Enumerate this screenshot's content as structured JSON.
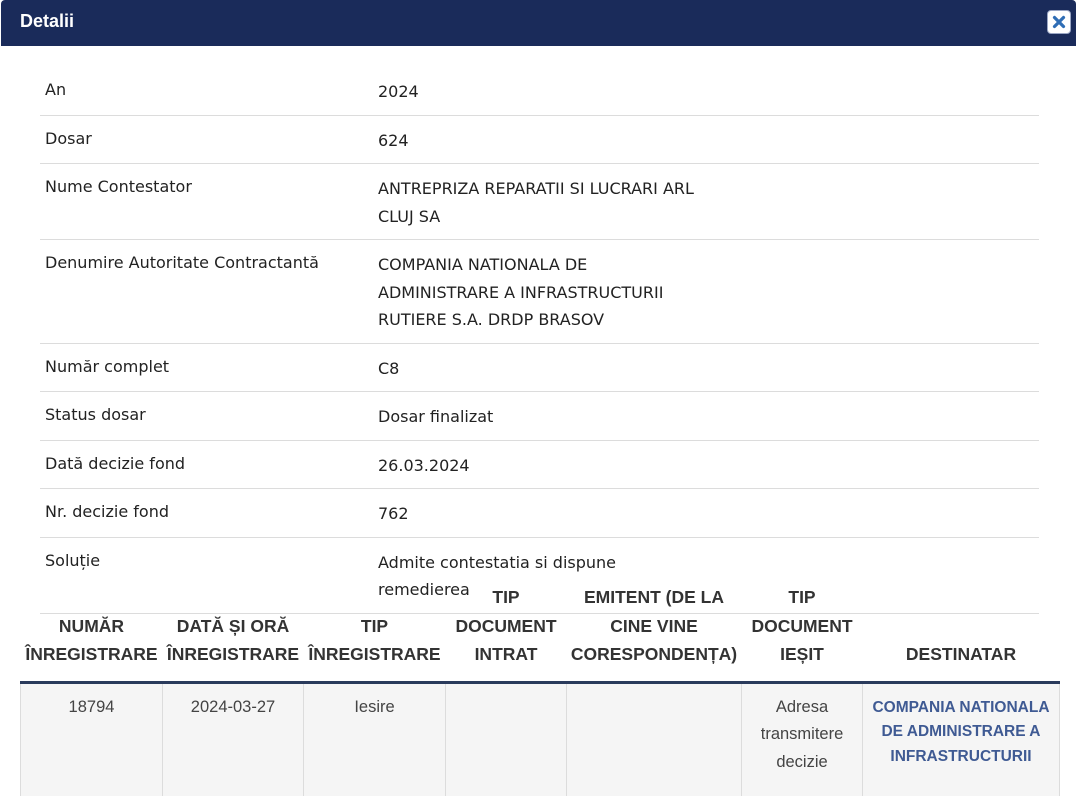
{
  "window": {
    "title": "Detalii"
  },
  "details": [
    {
      "label": "An",
      "value": "2024"
    },
    {
      "label": "Dosar",
      "value": "624"
    },
    {
      "label": "Nume Contestator",
      "value": "ANTREPRIZA REPARATII SI LUCRARI ARL CLUJ SA"
    },
    {
      "label": "Denumire Autoritate Contractantă",
      "value": "COMPANIA NATIONALA DE ADMINISTRARE A INFRASTRUCTURII RUTIERE S.A. DRDP BRASOV"
    },
    {
      "label": "Număr complet",
      "value": "C8"
    },
    {
      "label": "Status dosar",
      "value": "Dosar finalizat"
    },
    {
      "label": "Dată decizie fond",
      "value": "26.03.2024"
    },
    {
      "label": "Nr. decizie fond",
      "value": "762"
    },
    {
      "label": "Soluție",
      "value": "Admite contestatia si dispune remedierea"
    }
  ],
  "table": {
    "columns": [
      "NUMĂR ÎNREGISTRARE",
      "DATĂ ȘI ORĂ ÎNREGISTRARE",
      "TIP ÎNREGISTRARE",
      "TIP DOCUMENT INTRAT",
      "EMITENT (DE LA CINE VINE CORESPONDENȚA)",
      "TIP DOCUMENT IEȘIT",
      "DESTINATAR"
    ],
    "rows": [
      {
        "numar": "18794",
        "data": "2024-03-27",
        "tip_inregistrare": "Iesire",
        "tip_document_intrat": "",
        "emitent": "",
        "tip_document_iesit": "Adresa transmitere decizie",
        "destinatar": "COMPANIA NATIONALA DE ADMINISTRARE A INFRASTRUCTURII"
      }
    ]
  }
}
